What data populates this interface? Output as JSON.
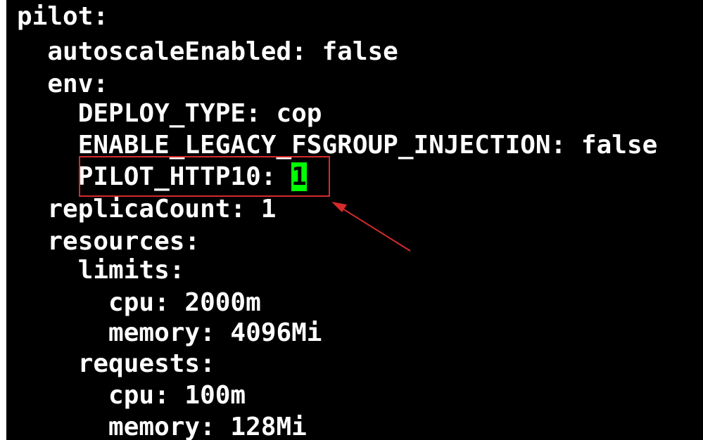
{
  "terminal": {
    "lines": [
      {
        "text": "pilot:"
      },
      {
        "text": "  autoscaleEnabled: false"
      },
      {
        "text": "  env:"
      },
      {
        "text": "    DEPLOY_TYPE: cop"
      },
      {
        "text": "    ENABLE_LEGACY_FSGROUP_INJECTION: false"
      },
      {
        "text": "    PILOT_HTTP10: ",
        "cursor_text": "1"
      },
      {
        "text": "  replicaCount: 1"
      },
      {
        "text": "  resources:"
      },
      {
        "text": "    limits:"
      },
      {
        "text": "      cpu: 2000m"
      },
      {
        "text": "      memory: 4096Mi"
      },
      {
        "text": "    requests:"
      },
      {
        "text": "      cpu: 100m"
      },
      {
        "text": "      memory: 128Mi"
      }
    ]
  },
  "colors": {
    "background": "#000000",
    "text": "#ffffff",
    "cursor": "#00ff00",
    "annotation": "#d52b2b"
  }
}
